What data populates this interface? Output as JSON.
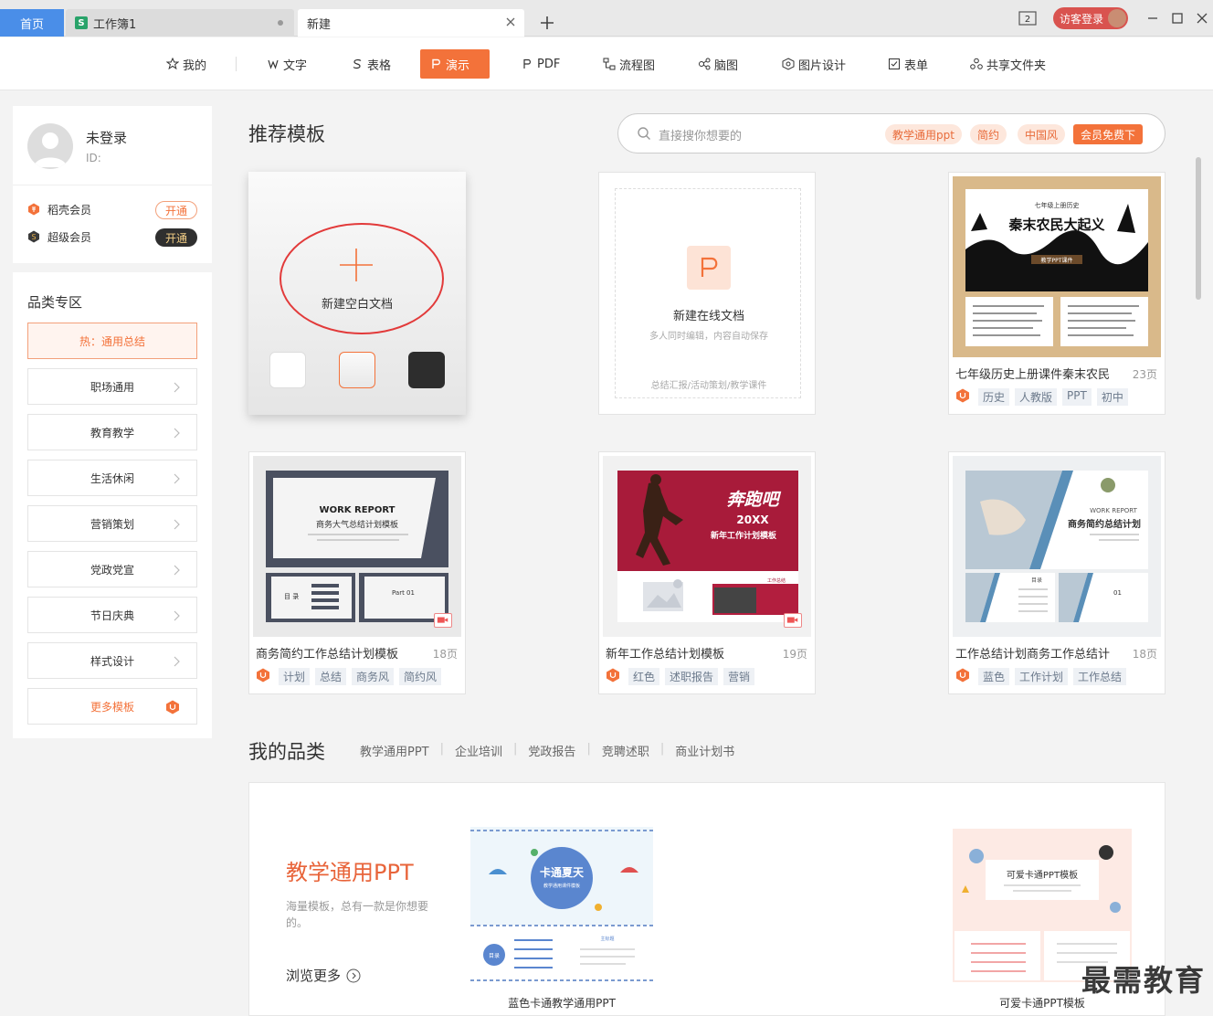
{
  "tabs": {
    "home": "首页",
    "workbook": "工作簿1",
    "new": "新建"
  },
  "window": {
    "count_badge": "2",
    "login": "访客登录"
  },
  "toolbar": [
    {
      "label": "我的",
      "icon": "star-icon"
    },
    {
      "label": "文字",
      "icon": "w-icon"
    },
    {
      "label": "表格",
      "icon": "s-icon"
    },
    {
      "label": "演示",
      "icon": "p-icon",
      "active": true
    },
    {
      "label": "PDF",
      "icon": "pdf-icon"
    },
    {
      "label": "流程图",
      "icon": "flowchart-icon"
    },
    {
      "label": "脑图",
      "icon": "mindmap-icon"
    },
    {
      "label": "图片设计",
      "icon": "image-design-icon"
    },
    {
      "label": "表单",
      "icon": "form-icon"
    },
    {
      "label": "共享文件夹",
      "icon": "shared-folder-icon"
    }
  ],
  "user": {
    "name": "未登录",
    "id": "ID:"
  },
  "membership": [
    {
      "label": "稻壳会员",
      "action": "开通"
    },
    {
      "label": "超级会员",
      "action": "开通"
    }
  ],
  "categories": {
    "title": "品类专区",
    "hot": "热：通用总结",
    "items": [
      "职场通用",
      "教育教学",
      "生活休闲",
      "营销策划",
      "党政党宣",
      "节日庆典",
      "样式设计"
    ],
    "more": "更多模板"
  },
  "main": {
    "title": "推荐模板",
    "search_placeholder": "直接搜你想要的",
    "search_tags": [
      "教学通用ppt",
      "简约",
      "中国风"
    ],
    "vip_tag": "会员免费下",
    "blank": "新建空白文档",
    "online": {
      "title": "新建在线文档",
      "sub": "多人同时编辑，内容自动保存",
      "foot": "总结汇报/活动策划/教学课件"
    }
  },
  "templates": [
    {
      "name": "七年级历史上册课件秦末农民...",
      "pages": "23页",
      "tags": [
        "历史",
        "人教版",
        "PPT",
        "初中"
      ],
      "thumb": {
        "line1": "七年级上册历史",
        "line2": "秦末农民大起义",
        "line3": "教学PPT课件"
      }
    },
    {
      "name": "商务简约工作总结计划模板",
      "pages": "18页",
      "tags": [
        "计划",
        "总结",
        "商务风",
        "简约风"
      ],
      "thumb": {
        "line1": "WORK REPORT",
        "line2": "商务大气总结计划模板",
        "line3": "目 录",
        "line4": "Part 01"
      }
    },
    {
      "name": "新年工作总结计划模板",
      "pages": "19页",
      "tags": [
        "红色",
        "述职报告",
        "营销"
      ],
      "thumb": {
        "line1": "奔跑吧",
        "line2": "20XX",
        "line3": "新年工作计划模板",
        "line4": "工作总结"
      }
    },
    {
      "name": "工作总结计划商务工作总结计...",
      "pages": "18页",
      "tags": [
        "蓝色",
        "工作计划",
        "工作总结"
      ],
      "thumb": {
        "line1": "WORK REPORT",
        "line2": "商务简约总结计划",
        "line3": "目录",
        "line4": "01"
      }
    }
  ],
  "my": {
    "title": "我的品类",
    "links": [
      "教学通用PPT",
      "企业培训",
      "党政报告",
      "竞聘述职",
      "商业计划书"
    ],
    "head": "教学通用PPT",
    "desc": "海量模板，总有一款是你想要的。",
    "browse": "浏览更多",
    "thumb1": {
      "line1": "卡通夏天",
      "line2": "教学通用课件模板",
      "line3": "目录",
      "line4": "主标题"
    },
    "thumb2": {
      "line1": "可爱卡通PPT模板"
    },
    "caption1": "蓝色卡通教学通用PPT",
    "caption2": "可爱卡通PPT模板"
  },
  "watermark": "最需教育",
  "colors": {
    "accent": "#f3723a",
    "tab_blue": "#4a8ee8",
    "ring": "#e23a3a"
  }
}
